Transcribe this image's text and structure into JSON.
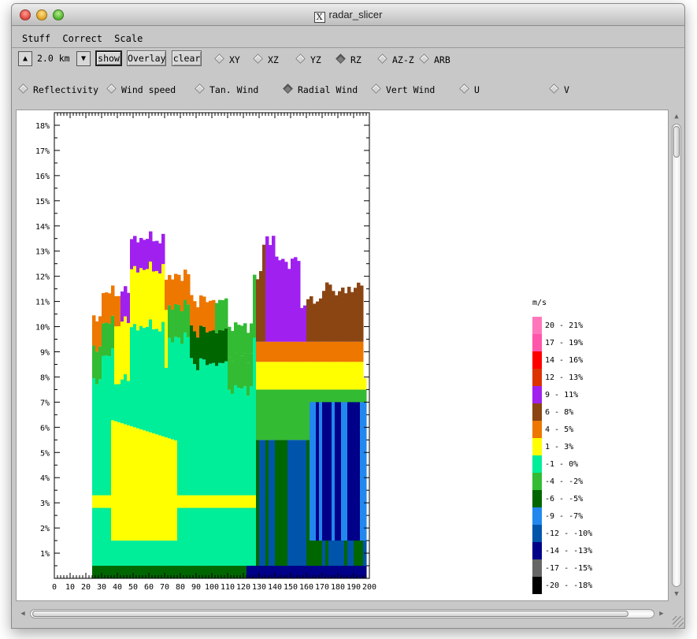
{
  "window": {
    "title": "radar_slicer"
  },
  "menu": [
    "Stuff",
    "Correct",
    "Scale"
  ],
  "toolbar": {
    "up_icon": "up-arrow",
    "height_label": "2.0 km",
    "down_icon": "down-arrow",
    "show_label": "show",
    "overlay_label": "Overlay",
    "clear_label": "clear",
    "views": [
      {
        "label": "XY",
        "selected": false
      },
      {
        "label": "XZ",
        "selected": false
      },
      {
        "label": "YZ",
        "selected": false
      },
      {
        "label": "RZ",
        "selected": true
      },
      {
        "label": "AZ-Z",
        "selected": false
      },
      {
        "label": "ARB",
        "selected": false
      }
    ]
  },
  "fields": [
    {
      "label": "Reflectivity",
      "selected": false
    },
    {
      "label": "Wind speed",
      "selected": false
    },
    {
      "label": "Tan. Wind",
      "selected": false
    },
    {
      "label": "Radial Wind",
      "selected": true
    },
    {
      "label": "Vert Wind",
      "selected": false
    },
    {
      "label": "U",
      "selected": false
    },
    {
      "label": "V",
      "selected": false
    }
  ],
  "chart_data": {
    "type": "heatmap",
    "x_ticks": [
      "0",
      "10",
      "20",
      "30",
      "40",
      "50",
      "60",
      "70",
      "80",
      "90",
      "100",
      "110",
      "120",
      "130",
      "140",
      "150",
      "160",
      "170",
      "180",
      "190",
      "200"
    ],
    "y_ticks": [
      "1%",
      "2%",
      "3%",
      "4%",
      "5%",
      "6%",
      "7%",
      "8%",
      "9%",
      "10%",
      "11%",
      "12%",
      "13%",
      "14%",
      "15%",
      "16%",
      "17%",
      "18%"
    ],
    "xlim": [
      0,
      200
    ],
    "ylim": [
      0,
      18.5
    ],
    "legend": {
      "unit": "m/s",
      "entries": [
        {
          "label": "20 - 21%",
          "color": "#ff77bb"
        },
        {
          "label": "17 - 19%",
          "color": "#ff55aa"
        },
        {
          "label": "14 - 16%",
          "color": "#ff0000"
        },
        {
          "label": "12 - 13%",
          "color": "#dd3300"
        },
        {
          "label": "9 - 11%",
          "color": "#a020f0"
        },
        {
          "label": "6 - 8%",
          "color": "#8b4513"
        },
        {
          "label": "4 - 5%",
          "color": "#ee7700"
        },
        {
          "label": "1 - 3%",
          "color": "#ffff00"
        },
        {
          "label": "-1 - 0%",
          "color": "#00ee99"
        },
        {
          "label": "-4 - -2%",
          "color": "#33bb33"
        },
        {
          "label": "-6 - -5%",
          "color": "#006600"
        },
        {
          "label": "-9 - -7%",
          "color": "#2288ee"
        },
        {
          "label": "-12 - -10%",
          "color": "#0055aa"
        },
        {
          "label": "-14 - -13%",
          "color": "#000088"
        },
        {
          "label": "-17 - -15%",
          "color": "#666666"
        },
        {
          "label": "-20 - -18%",
          "color": "#000000"
        }
      ]
    }
  }
}
